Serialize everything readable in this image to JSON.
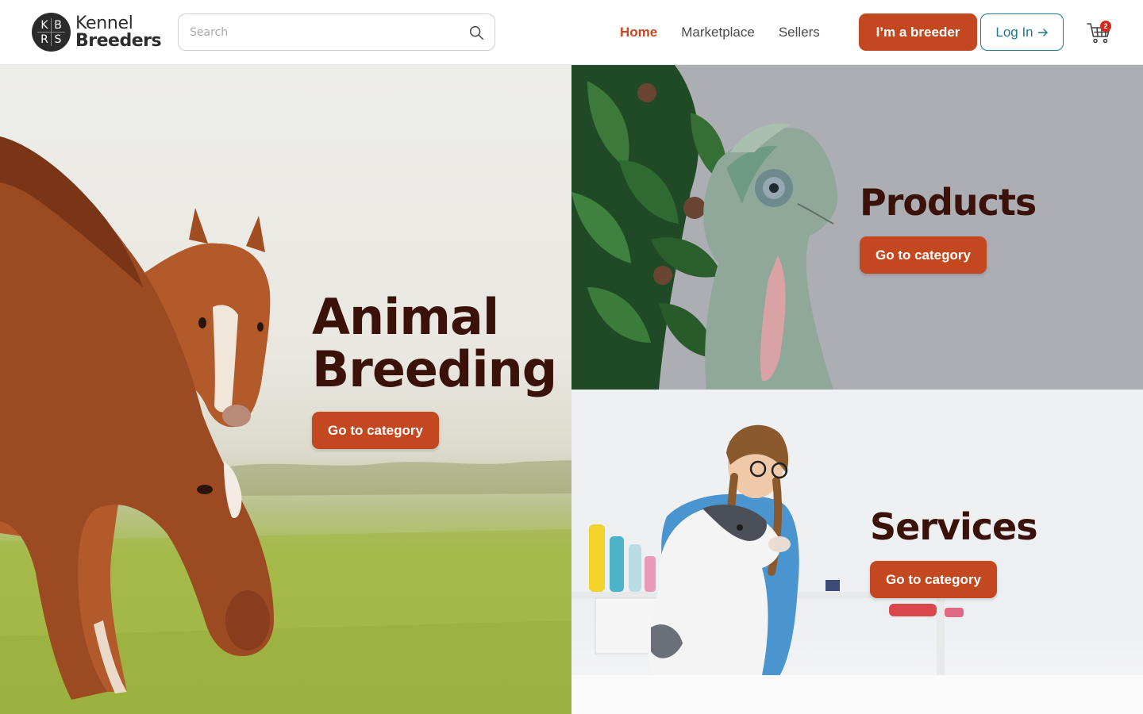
{
  "brand": {
    "badge_letters": [
      "K",
      "B",
      "R",
      "S"
    ],
    "line1": "Kennel",
    "line2": "Breeders"
  },
  "search": {
    "placeholder": "Search",
    "value": ""
  },
  "nav": {
    "items": [
      {
        "label": "Home",
        "active": true
      },
      {
        "label": "Marketplace",
        "active": false
      },
      {
        "label": "Sellers",
        "active": false
      }
    ]
  },
  "actions": {
    "breeder_label": "I’m a breeder",
    "login_label": "Log In",
    "cart_count": "2"
  },
  "categories": {
    "animal_breeding": {
      "title_line1": "Animal",
      "title_line2": "Breeding",
      "cta": "Go to category"
    },
    "products": {
      "title": "Products",
      "cta": "Go to category"
    },
    "services": {
      "title": "Services",
      "cta": "Go to category"
    }
  },
  "colors": {
    "accent": "#c4481f",
    "heading": "#3a120a",
    "login_outline": "#1d7a93",
    "badge": "#d9261c"
  },
  "icons": [
    "search-icon",
    "arrow-right-icon",
    "shopping-cart-icon"
  ]
}
